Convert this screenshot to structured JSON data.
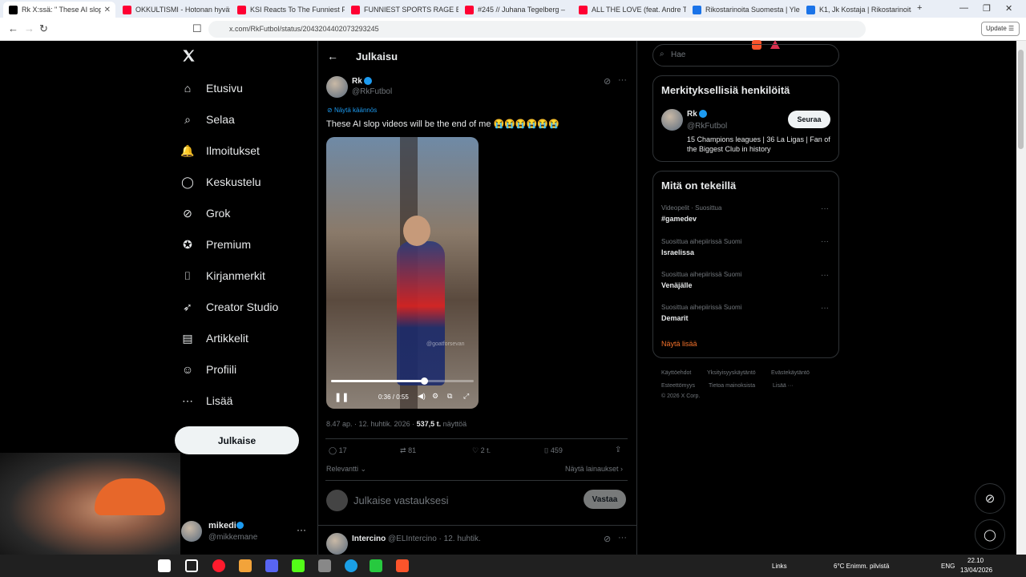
{
  "browser": {
    "tabs": [
      {
        "label": "Rk X:ssä: \" These AI slop",
        "color": "#000000",
        "active": true
      },
      {
        "label": "OKKULTISMI - Hotonan hyväty",
        "color": "#ff0033"
      },
      {
        "label": "KSI Reacts To The Funniest FLI",
        "color": "#ff0033"
      },
      {
        "label": "FUNNIEST SPORTS RAGE BAITS",
        "color": "#ff0033"
      },
      {
        "label": "#245 // Juhana Tegelberg –",
        "color": "#ff0033"
      },
      {
        "label": "ALL THE LOVE (feat. Andre Tro",
        "color": "#ff0033"
      },
      {
        "label": "Rikostarinoita Suomesta | Yle A",
        "color": "#1a73e8"
      },
      {
        "label": "K1, Jk Kostaja | Rikostarinoita",
        "color": "#1a73e8"
      }
    ],
    "url": "x.com/RkFutbol/status/2043204402073293245",
    "update_label": "Update"
  },
  "nav": {
    "items": [
      {
        "label": "Etusivu",
        "icon": "home-icon"
      },
      {
        "label": "Selaa",
        "icon": "search-icon"
      },
      {
        "label": "Ilmoitukset",
        "icon": "bell-icon"
      },
      {
        "label": "Keskustelu",
        "icon": "chat-icon"
      },
      {
        "label": "Grok",
        "icon": "grok-icon"
      },
      {
        "label": "Premium",
        "icon": "premium-icon"
      },
      {
        "label": "Kirjanmerkit",
        "icon": "bookmark-icon"
      },
      {
        "label": "Creator Studio",
        "icon": "rocket-icon"
      },
      {
        "label": "Artikkelit",
        "icon": "article-icon"
      },
      {
        "label": "Profiili",
        "icon": "profile-icon"
      },
      {
        "label": "Lisää",
        "icon": "more-icon"
      }
    ],
    "post_button": "Julkaise",
    "account": {
      "name": "mikedi",
      "handle": "@mikkemane"
    }
  },
  "post": {
    "header_title": "Julkaisu",
    "author_name": "Rk",
    "author_handle": "@RkFutbol",
    "translate_label": "Näytä käännös",
    "text": "These AI slop videos will be the end of me 😭😭😭😭😭😭",
    "video": {
      "time": "0:36 / 0:55",
      "progress": 0.65,
      "watermark": "@goatforsevan"
    },
    "meta_time": "8.47 ap. · 12. huhtik. 2026 ·",
    "meta_views_count": "537,5 t.",
    "meta_views_label": "näyttöä",
    "stats": {
      "replies": "17",
      "reposts": "81",
      "likes": "2 t.",
      "bookmarks": "459"
    },
    "sort_label": "Relevantti",
    "quotes_label": "Näytä lainaukset",
    "reply_placeholder": "Julkaise vastauksesi",
    "reply_button": "Vastaa",
    "next_author": "Intercino",
    "next_handle": "@ELIntercino · 12. huhtik."
  },
  "sidebar": {
    "search_placeholder": "Hae",
    "relevant_title": "Merkityksellisiä henkilöitä",
    "person": {
      "name": "Rk",
      "handle": "@RkFutbol",
      "bio": "15 Champions leagues | 36 La Ligas | Fan of the Biggest Club in history",
      "follow": "Seuraa"
    },
    "trends_title": "Mitä on tekeillä",
    "trends": [
      {
        "meta": "Videopelit · Suosittua",
        "name": "#gamedev"
      },
      {
        "meta": "Suosittua aihepiirissä Suomi",
        "name": "Israelissa"
      },
      {
        "meta": "Suosittua aihepiirissä Suomi",
        "name": "Venäjälle"
      },
      {
        "meta": "Suosittua aihepiirissä Suomi",
        "name": "Demarit"
      }
    ],
    "show_more": "Näytä lisää",
    "footer": [
      "Käyttöehdot",
      "Yksityisyyskäytäntö",
      "Evästekäytäntö",
      "Esteettömyys",
      "Tietoa mainoksista",
      "Lisää ···",
      "© 2026 X Corp."
    ]
  },
  "taskbar": {
    "links": "Links",
    "weather": "6°C  Enimm. pilvistä",
    "lang": "ENG",
    "time": "22.10",
    "date": "13/04/2026"
  }
}
